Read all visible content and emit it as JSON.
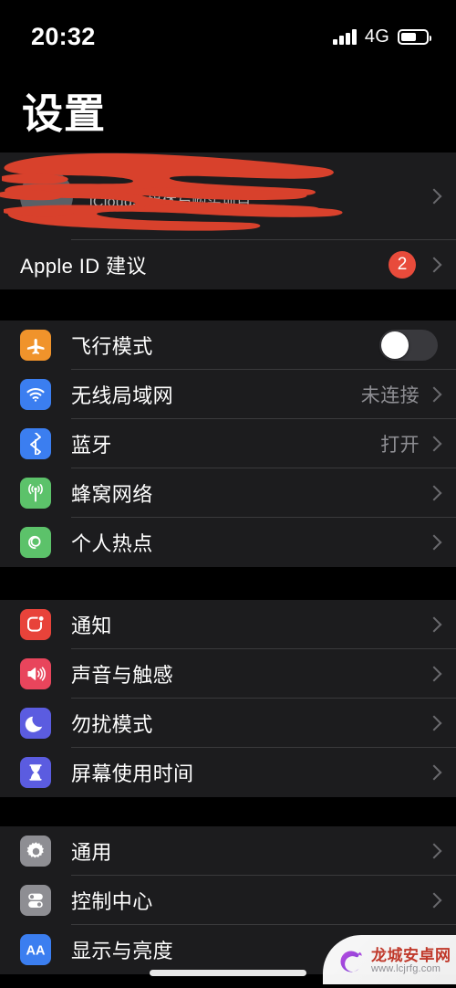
{
  "status_bar": {
    "time": "20:32",
    "network_type": "4G",
    "signal_bars": 4,
    "battery_level_pct": 62
  },
  "header": {
    "title": "设置"
  },
  "apple_id": {
    "name_redacted": "",
    "subtitle_partial": "iCloud、媒体与购买项目",
    "redacted": true,
    "redaction_color": "#d8412c"
  },
  "suggestion_row": {
    "label": "Apple ID 建议",
    "badge": "2",
    "badge_color": "#e84b3b"
  },
  "groups": [
    {
      "id": "connectivity",
      "rows": [
        {
          "label": "飞行模式",
          "icon": "airplane-icon",
          "icon_color": "#f0932b",
          "control": "toggle",
          "toggle_on": false,
          "value": ""
        },
        {
          "label": "无线局域网",
          "icon": "wifi-icon",
          "icon_color": "#3b7ef0",
          "control": "chevron",
          "value": "未连接"
        },
        {
          "label": "蓝牙",
          "icon": "bluetooth-icon",
          "icon_color": "#3b7ef0",
          "control": "chevron",
          "value": "打开"
        },
        {
          "label": "蜂窝网络",
          "icon": "cellular-icon",
          "icon_color": "#5cc26a",
          "control": "chevron",
          "value": ""
        },
        {
          "label": "个人热点",
          "icon": "hotspot-icon",
          "icon_color": "#5cc26a",
          "control": "chevron",
          "value": ""
        }
      ]
    },
    {
      "id": "alerts",
      "rows": [
        {
          "label": "通知",
          "icon": "notifications-icon",
          "icon_color": "#e8433a",
          "control": "chevron",
          "value": ""
        },
        {
          "label": "声音与触感",
          "icon": "sounds-icon",
          "icon_color": "#e8455c",
          "control": "chevron",
          "value": ""
        },
        {
          "label": "勿扰模式",
          "icon": "moon-icon",
          "icon_color": "#5b5ce0",
          "control": "chevron",
          "value": ""
        },
        {
          "label": "屏幕使用时间",
          "icon": "hourglass-icon",
          "icon_color": "#5b5ce0",
          "control": "chevron",
          "value": ""
        }
      ]
    },
    {
      "id": "system",
      "rows": [
        {
          "label": "通用",
          "icon": "gear-icon",
          "icon_color": "#8e8e93",
          "control": "chevron",
          "value": ""
        },
        {
          "label": "控制中心",
          "icon": "control-center-icon",
          "icon_color": "#8e8e93",
          "control": "chevron",
          "value": ""
        },
        {
          "label": "显示与亮度",
          "icon": "display-brightness-icon",
          "icon_color": "#3b7ef0",
          "control": "chevron",
          "value": ""
        }
      ]
    }
  ],
  "watermark": {
    "site_name": "龙城安卓网",
    "url": "www.lcjrfg.com"
  }
}
